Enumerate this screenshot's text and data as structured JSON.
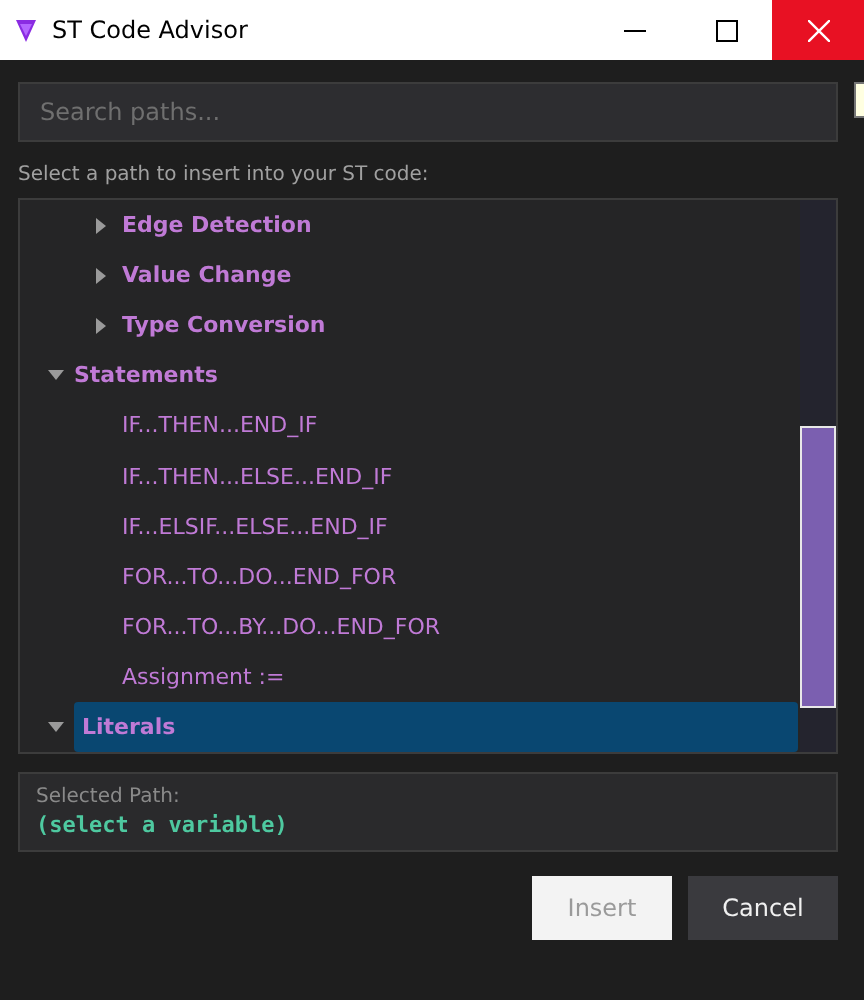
{
  "window": {
    "title": "ST Code Advisor"
  },
  "search": {
    "placeholder": "Search paths..."
  },
  "instruction": "Select a path to insert into your ST code:",
  "tree": [
    {
      "children": [
        {
          "label": "Edge Detection",
          "kind": "group",
          "expanded": false,
          "selected": false
        },
        {
          "label": "Value Change",
          "kind": "group",
          "expanded": false,
          "selected": false
        },
        {
          "label": "Type Conversion",
          "kind": "group",
          "expanded": false,
          "selected": false
        }
      ]
    },
    {
      "label": "Statements",
      "kind": "group",
      "expanded": true,
      "selected": false,
      "children": [
        {
          "label": "IF...THEN...END_IF",
          "kind": "leaf",
          "selected": false
        },
        {
          "label": "IF...THEN...ELSE...END_IF",
          "kind": "leaf",
          "selected": false
        },
        {
          "label": "IF...ELSIF...ELSE...END_IF",
          "kind": "leaf",
          "selected": false
        },
        {
          "label": "FOR...TO...DO...END_FOR",
          "kind": "leaf",
          "selected": false
        },
        {
          "label": "FOR...TO...BY...DO...END_FOR",
          "kind": "leaf",
          "selected": false
        },
        {
          "label": "Assignment :=",
          "kind": "leaf",
          "selected": false
        }
      ]
    },
    {
      "label": "Literals",
      "kind": "group",
      "expanded": true,
      "selected": true
    }
  ],
  "selected_path": {
    "label": "Selected Path:",
    "value": "(select a variable)"
  },
  "buttons": [
    {
      "label": "Insert",
      "disabled": true
    },
    {
      "label": "Cancel",
      "disabled": false
    }
  ]
}
